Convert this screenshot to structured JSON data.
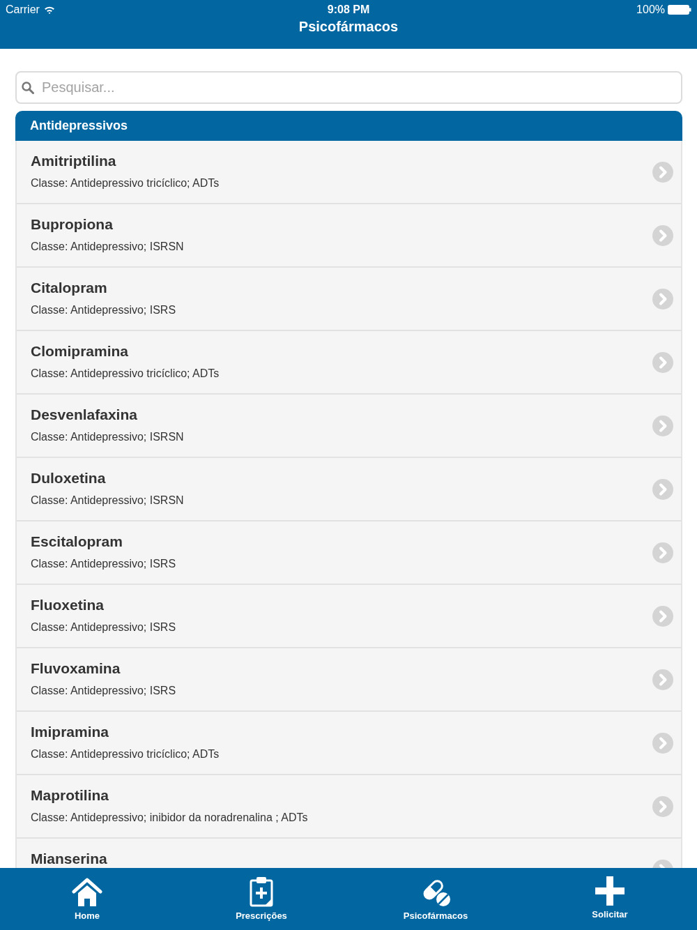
{
  "status_bar": {
    "carrier": "Carrier",
    "time": "9:08 PM",
    "battery": "100%"
  },
  "nav_bar": {
    "title": "Psicofármacos"
  },
  "search": {
    "placeholder": "Pesquisar..."
  },
  "section": {
    "title": "Antidepressivos",
    "items": [
      {
        "name": "Amitriptilina",
        "subtitle": "Classe: Antidepressivo tricíclico; ADTs"
      },
      {
        "name": "Bupropiona",
        "subtitle": "Classe: Antidepressivo; ISRSN"
      },
      {
        "name": "Citalopram",
        "subtitle": "Classe: Antidepressivo; ISRS"
      },
      {
        "name": "Clomipramina",
        "subtitle": "Classe: Antidepressivo tricíclico; ADTs"
      },
      {
        "name": "Desvenlafaxina",
        "subtitle": "Classe: Antidepressivo; ISRSN"
      },
      {
        "name": "Duloxetina",
        "subtitle": "Classe: Antidepressivo; ISRSN"
      },
      {
        "name": "Escitalopram",
        "subtitle": "Classe: Antidepressivo; ISRS"
      },
      {
        "name": "Fluoxetina",
        "subtitle": "Classe: Antidepressivo; ISRS"
      },
      {
        "name": "Fluvoxamina",
        "subtitle": "Classe: Antidepressivo; ISRS"
      },
      {
        "name": "Imipramina",
        "subtitle": "Classe: Antidepressivo tricíclico; ADTs"
      },
      {
        "name": "Maprotilina",
        "subtitle": "Classe: Antidepressivo; inibidor da noradrenalina ; ADTs"
      },
      {
        "name": "Mianserina"
      }
    ]
  },
  "tab_bar": {
    "items": [
      {
        "label": "Home",
        "kind": "home"
      },
      {
        "label": "Prescrições",
        "kind": "clipboard"
      },
      {
        "label": "Psicofármacos",
        "kind": "pills"
      },
      {
        "label": "Solicitar",
        "kind": "plus"
      }
    ]
  }
}
